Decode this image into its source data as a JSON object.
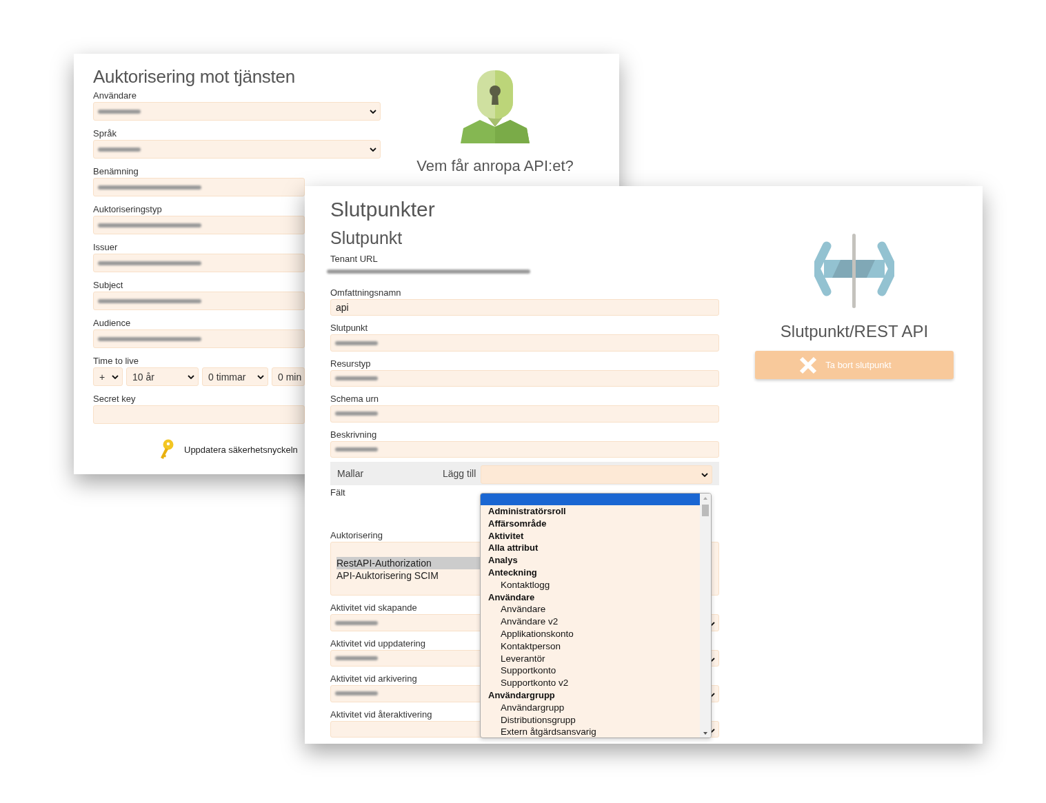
{
  "back_window": {
    "title": "Auktorisering mot tjänsten",
    "fields": [
      {
        "label": "Användare",
        "kind": "select",
        "blurred": true
      },
      {
        "label": "Språk",
        "kind": "select",
        "blurred": true
      },
      {
        "label": "Benämning",
        "kind": "text",
        "blurred": true
      },
      {
        "label": "Auktoriseringstyp",
        "kind": "text",
        "blurred": true
      },
      {
        "label": "Issuer",
        "kind": "text",
        "blurred": true
      },
      {
        "label": "Subject",
        "kind": "text",
        "blurred": true
      },
      {
        "label": "Audience",
        "kind": "text",
        "blurred": true
      },
      {
        "label": "Time to live",
        "kind": "time",
        "selects": [
          "+",
          "10 år",
          "0 timmar",
          "0 min"
        ]
      },
      {
        "label": "Secret key",
        "kind": "text",
        "blurred": false
      }
    ],
    "update_key_link": "Uppdatera säkerhetsnyckeln",
    "caption": "Vem får anropa API:et?"
  },
  "front_window": {
    "title": "Slutpunkter",
    "subtitle": "Slutpunkt",
    "tenant_url": {
      "label": "Tenant URL",
      "blurred": true
    },
    "fields": [
      {
        "label": "Omfattningsnamn",
        "kind": "text",
        "value": "api"
      },
      {
        "label": "Slutpunkt",
        "kind": "text",
        "blurred": true
      },
      {
        "label": "Resurstyp",
        "kind": "text",
        "blurred": true
      },
      {
        "label": "Schema urn",
        "kind": "text",
        "blurred": true
      },
      {
        "label": "Beskrivning",
        "kind": "text",
        "blurred": true
      }
    ],
    "templates_bar": {
      "label": "Mallar",
      "add_label": "Lägg till"
    },
    "fields_label": "Fält",
    "authorization": {
      "label": "Auktorisering",
      "options": [
        {
          "text": "RestAPI-Authorization",
          "selected": true
        },
        {
          "text": "API-Auktorisering SCIM",
          "selected": false
        }
      ]
    },
    "activity_fields": [
      {
        "label": "Aktivitet vid skapande",
        "kind": "select",
        "blurred": true
      },
      {
        "label": "Aktivitet vid uppdatering",
        "kind": "select",
        "blurred": true
      },
      {
        "label": "Aktivitet vid arkivering",
        "kind": "select",
        "blurred": true
      },
      {
        "label": "Aktivitet vid återaktivering",
        "kind": "select",
        "blurred": false
      }
    ],
    "caption": "Slutpunkt/REST API",
    "delete_button": "Ta bort slutpunkt"
  },
  "dropdown": {
    "blank_option_highlighted": true,
    "groups": [
      {
        "label": "Administratörsroll"
      },
      {
        "label": "Affärsområde"
      },
      {
        "label": "Aktivitet"
      },
      {
        "label": "Alla attribut"
      },
      {
        "label": "Analys"
      },
      {
        "label": "Anteckning",
        "children": [
          "Kontaktlogg"
        ]
      },
      {
        "label": "Användare",
        "children": [
          "Användare",
          "Användare v2",
          "Applikationskonto",
          "Kontaktperson",
          "Leverantör",
          "Supportkonto",
          "Supportkonto v2"
        ]
      },
      {
        "label": "Användargrupp",
        "children": [
          "Användargrupp",
          "Distributionsgrupp",
          "Extern åtgärdsansvarig"
        ]
      }
    ]
  }
}
